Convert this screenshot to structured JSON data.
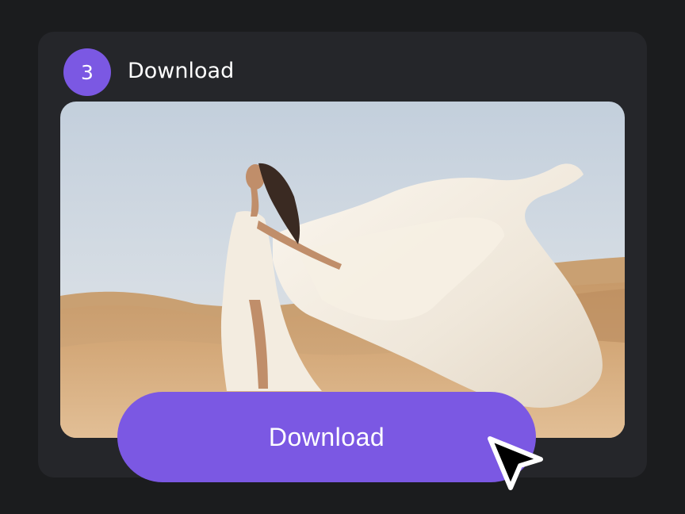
{
  "step": {
    "number": "3",
    "title": "Download"
  },
  "preview": {
    "image_icon": "photo-woman-white-dress-desert-dunes"
  },
  "action": {
    "download_label": "Download"
  },
  "pointer": {
    "icon": "mouse-cursor-arrow-icon"
  },
  "colors": {
    "background": "#1b1c1e",
    "card": "#25262a",
    "accent": "#7b58e3",
    "text": "#ffffff"
  }
}
